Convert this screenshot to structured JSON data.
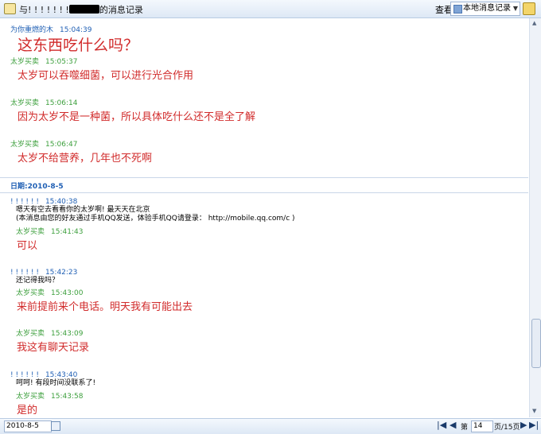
{
  "window": {
    "title_prefix": "与! ! ! ! ! ! !",
    "title_suffix": "的消息记录",
    "view_label": "查看",
    "record_source": "本地消息记录",
    "dropdown_arrow": "▼",
    "select_icon": "history-icon",
    "tool_icon": "export-icon"
  },
  "messages_top": [
    {
      "sender": "为你重燃的木",
      "time": "15:04:39",
      "text": "这东西吃什么吗？"
    },
    {
      "sender": "太岁买卖",
      "time": "15:05:37",
      "text": "太岁可以吞噬细菌，可以进行光合作用"
    },
    {
      "sender": "太岁买卖",
      "time": "15:06:14",
      "text": "因为太岁不是一种菌，所以具体吃什么还不是全了解"
    },
    {
      "sender": "太岁买卖",
      "time": "15:06:47",
      "text": "太岁不给营养，几年也不死啊"
    }
  ],
  "date_header": "日期:2010-8-5",
  "messages_day": [
    {
      "sender": "! ! ! ! ! !",
      "time": "15:40:38",
      "line1": "嗯天有空去看看你的太岁啊! 最天天在北京",
      "line2": "(本消息由您的好友通过手机QQ发送，体验手机QQ请登录： http://mobile.qq.com/c )"
    },
    {
      "sender": "太岁买卖",
      "time": "15:41:43",
      "text": "可以"
    },
    {
      "sender": "! ! ! ! ! !",
      "time": "15:42:23",
      "line1": "还记得我吗？"
    },
    {
      "sender": "太岁买卖",
      "time": "15:43:00",
      "text": "来前提前来个电话。明天我有可能出去"
    },
    {
      "sender": "太岁买卖",
      "time": "15:43:09",
      "text": "我这有聊天记录"
    },
    {
      "sender": "! ! ! ! ! !",
      "time": "15:43:40",
      "line1": "呵呵! 有段时间没联系了!"
    },
    {
      "sender": "太岁买卖",
      "time": "15:43:58",
      "text": "是的"
    }
  ],
  "statusbar": {
    "date_value": "2010-8-5",
    "first": "|◀",
    "prev": "◀",
    "page_prefix": "第",
    "page_value": "14",
    "page_suffix": "页/15页",
    "next": "▶",
    "last": "▶|"
  },
  "scrollbar": {
    "up": "▲",
    "down": "▼"
  }
}
